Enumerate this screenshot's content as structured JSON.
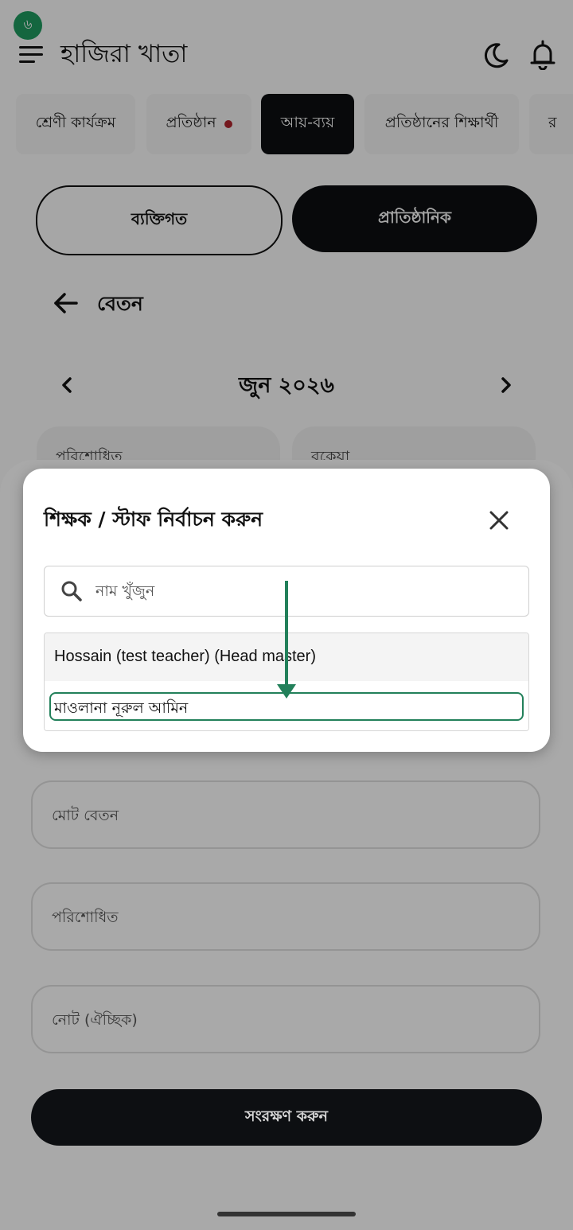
{
  "status": {
    "avatar_text": "৬"
  },
  "header": {
    "title": "হাজিরা খাতা",
    "menu_icon": "menu-icon",
    "theme_icon": "moon-icon",
    "notification_icon": "bell-icon"
  },
  "tabs": [
    {
      "label": "শ্রেণী কার্যক্রম",
      "active": false
    },
    {
      "label": "প্রতিষ্ঠান",
      "active": false,
      "dot": true
    },
    {
      "label": "আয়-ব্যয়",
      "active": true
    },
    {
      "label": "প্রতিষ্ঠানের শিক্ষার্থী",
      "active": false
    },
    {
      "label": "র",
      "active": false
    }
  ],
  "segments": {
    "personal": "ব্যক্তিগত",
    "institutional": "প্রাতিষ্ঠানিক",
    "selected": "institutional"
  },
  "section": {
    "title": "বেতন"
  },
  "month_nav": {
    "label": "জুন ২০২৬"
  },
  "summary_cards": {
    "paid": "পরিশোধিত",
    "due": "বকেয়া"
  },
  "form": {
    "total_salary": "মোট বেতন",
    "paid": "পরিশোধিত",
    "note": "নোট (ঐচ্ছিক)",
    "save": "সংরক্ষণ করুন"
  },
  "dialog": {
    "title": "শিক্ষক / স্টাফ নির্বাচন করুন",
    "search_placeholder": "নাম খুঁজুন",
    "search_value": "",
    "options": [
      "Hossain (test teacher) (Head master)",
      "মাওলানা নূরুল আমিন"
    ]
  },
  "annotation": {
    "color": "#22805a"
  }
}
